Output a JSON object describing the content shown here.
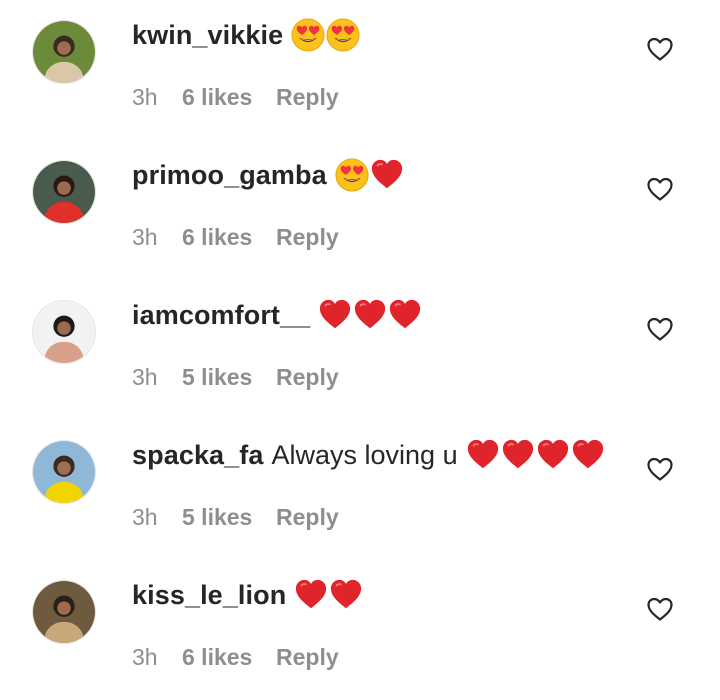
{
  "comments": [
    {
      "username": "kwin_vikkie",
      "text": "",
      "emojis": [
        "heart-eyes",
        "heart-eyes"
      ],
      "time": "3h",
      "likes": "6 likes",
      "reply": "Reply",
      "avatar_colors": [
        "#6b8a3a",
        "#d9c7a8",
        "#3a2a1f"
      ]
    },
    {
      "username": "primoo_gamba",
      "text": "",
      "emojis": [
        "heart-eyes",
        "red-heart"
      ],
      "time": "3h",
      "likes": "6 likes",
      "reply": "Reply",
      "avatar_colors": [
        "#4a5a4c",
        "#e0302a",
        "#2a1a14"
      ]
    },
    {
      "username": "iamcomfort__",
      "text": "",
      "emojis": [
        "red-heart",
        "red-heart",
        "red-heart"
      ],
      "time": "3h",
      "likes": "5 likes",
      "reply": "Reply",
      "avatar_colors": [
        "#f2f2f2",
        "#d8a08a",
        "#1e1a18"
      ]
    },
    {
      "username": "spacka_fa",
      "text": "Always loving u",
      "emojis": [
        "red-heart",
        "red-heart",
        "red-heart",
        "red-heart"
      ],
      "time": "3h",
      "likes": "5 likes",
      "reply": "Reply",
      "avatar_colors": [
        "#8fb7d8",
        "#f2d400",
        "#3a2a20"
      ]
    },
    {
      "username": "kiss_le_lion",
      "text": "",
      "emojis": [
        "red-heart",
        "red-heart"
      ],
      "time": "3h",
      "likes": "6 likes",
      "reply": "Reply",
      "avatar_colors": [
        "#6e5a3e",
        "#c8a878",
        "#2a2018"
      ]
    }
  ],
  "colors": {
    "text_primary": "#262626",
    "text_secondary": "#8e8e8e",
    "heart_red": "#e0242c",
    "emoji_yellow": "#fcc21b"
  },
  "icons": {
    "like": "heart-outline-icon"
  }
}
